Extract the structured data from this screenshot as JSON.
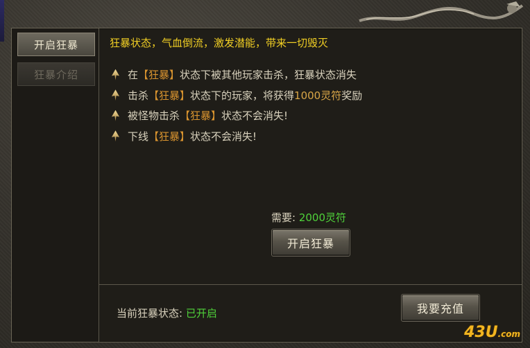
{
  "tabs": {
    "open_label": "开启狂暴",
    "intro_label": "狂暴介绍"
  },
  "main": {
    "headline": "狂暴状态，气血倒流，激发潜能，带来一切毁灭",
    "rules": [
      {
        "pre": "在",
        "tag": "【狂暴】",
        "post": "状态下被其他玩家击杀，狂暴状态消失"
      },
      {
        "pre": "击杀",
        "tag": "【狂暴】",
        "mid": "状态下的玩家，将获得",
        "reward": "1000灵符",
        "post": "奖励"
      },
      {
        "pre": "被怪物击杀",
        "tag": "【狂暴】",
        "post": "状态不会消失!"
      },
      {
        "pre": "下线",
        "tag": "【狂暴】",
        "post": "状态不会消失!"
      }
    ],
    "cost_label": "需要:",
    "cost_value": "2000灵符",
    "open_button": "开启狂暴",
    "status_label": "当前狂暴状态:",
    "status_value": "已开启",
    "recharge_button": "我要充值"
  },
  "watermark": {
    "logo": "43U",
    "suffix": ".com"
  },
  "colors": {
    "headline": "#f1cf24",
    "tag": "#d9942f",
    "reward": "#d9a647",
    "green": "#4fd23a"
  },
  "icons": {
    "rule_bullet": "diamond-arrow-icon",
    "corner_ornament": "dragon-ornament-icon"
  }
}
